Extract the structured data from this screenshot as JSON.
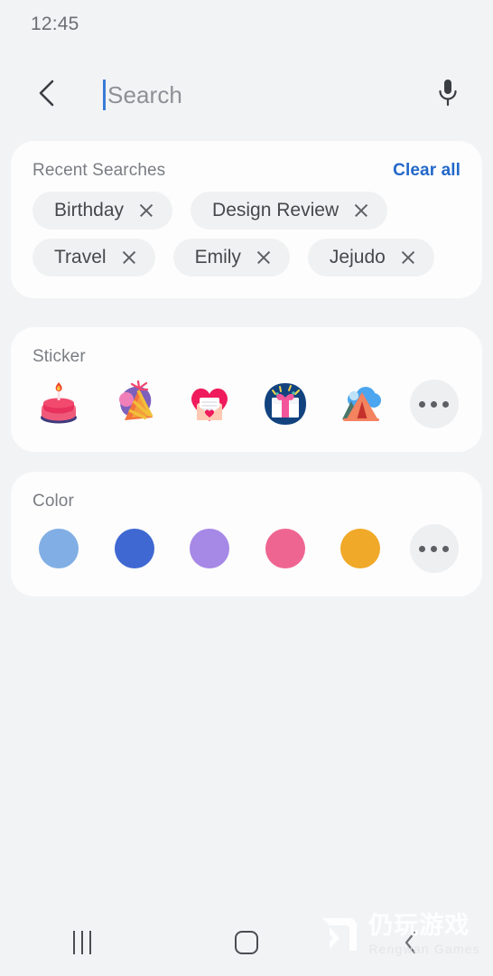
{
  "status": {
    "clock": "12:45"
  },
  "search": {
    "back_icon": "chevron-left-icon",
    "placeholder": "Search",
    "value": "",
    "mic_icon": "microphone-icon"
  },
  "recent": {
    "title": "Recent Searches",
    "clear_all": "Clear all",
    "clear_color": "#2268c9",
    "rows": [
      [
        {
          "label": "Birthday",
          "remove_icon": "close-icon"
        },
        {
          "label": "Design Review",
          "remove_icon": "close-icon"
        }
      ],
      [
        {
          "label": "Travel",
          "remove_icon": "close-icon"
        },
        {
          "label": "Emily",
          "remove_icon": "close-icon"
        },
        {
          "label": "Jejudo",
          "remove_icon": "close-icon"
        }
      ]
    ]
  },
  "sticker": {
    "title": "Sticker",
    "items": [
      {
        "name": "birthday-cake-sticker"
      },
      {
        "name": "party-hat-sticker"
      },
      {
        "name": "love-letter-sticker"
      },
      {
        "name": "gift-box-sticker"
      },
      {
        "name": "camping-tent-sticker"
      }
    ],
    "more_label": "more-sticker-button"
  },
  "color": {
    "title": "Color",
    "items": [
      {
        "name": "color-light-blue",
        "hex": "#81aee4"
      },
      {
        "name": "color-blue",
        "hex": "#3f68d2"
      },
      {
        "name": "color-purple",
        "hex": "#a688e6"
      },
      {
        "name": "color-pink",
        "hex": "#ef6591"
      },
      {
        "name": "color-orange",
        "hex": "#f0a928"
      }
    ],
    "more_label": "more-color-button"
  },
  "nav": {
    "recents_icon": "recents-icon",
    "home_icon": "home-icon",
    "back_icon": "back-icon"
  },
  "watermark": {
    "cn": "仍玩游戏",
    "en": "Rengwan Games"
  }
}
